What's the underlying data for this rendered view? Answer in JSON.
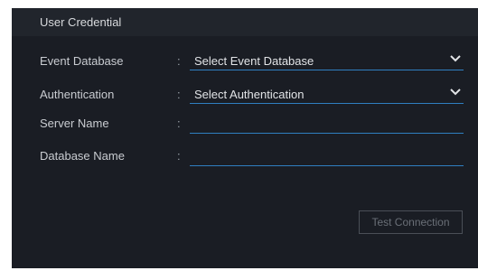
{
  "section": {
    "title": "User Credential"
  },
  "fields": [
    {
      "label": "Event Database",
      "separator": ":",
      "value": "Select Event Database",
      "type": "select",
      "icon": "chevron-down-icon"
    },
    {
      "label": "Authentication",
      "separator": ":",
      "value": "Select Authentication",
      "type": "select",
      "icon": "chevron-down-icon"
    },
    {
      "label": "Server Name",
      "separator": ":",
      "value": "",
      "type": "text"
    },
    {
      "label": "Database Name",
      "separator": ":",
      "value": "",
      "type": "text"
    }
  ],
  "actions": {
    "test_connection_label": "Test Connection",
    "test_connection_disabled": true
  },
  "colors": {
    "panel_background": "#1a1d24",
    "header_background": "#21252c",
    "field_underline": "#2f7fc1",
    "disabled_text": "#6a6f77"
  }
}
